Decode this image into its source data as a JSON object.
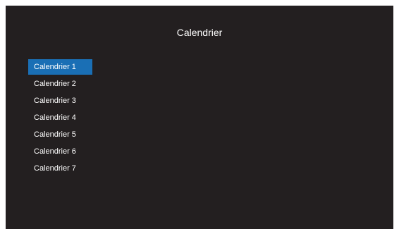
{
  "screen": {
    "title": "Calendrier",
    "background_color": "#231f20",
    "selection_color": "#1a6fb5",
    "items": [
      {
        "label": "Calendrier 1",
        "selected": true
      },
      {
        "label": "Calendrier 2",
        "selected": false
      },
      {
        "label": "Calendrier 3",
        "selected": false
      },
      {
        "label": "Calendrier 4",
        "selected": false
      },
      {
        "label": "Calendrier 5",
        "selected": false
      },
      {
        "label": "Calendrier 6",
        "selected": false
      },
      {
        "label": "Calendrier 7",
        "selected": false
      }
    ]
  }
}
